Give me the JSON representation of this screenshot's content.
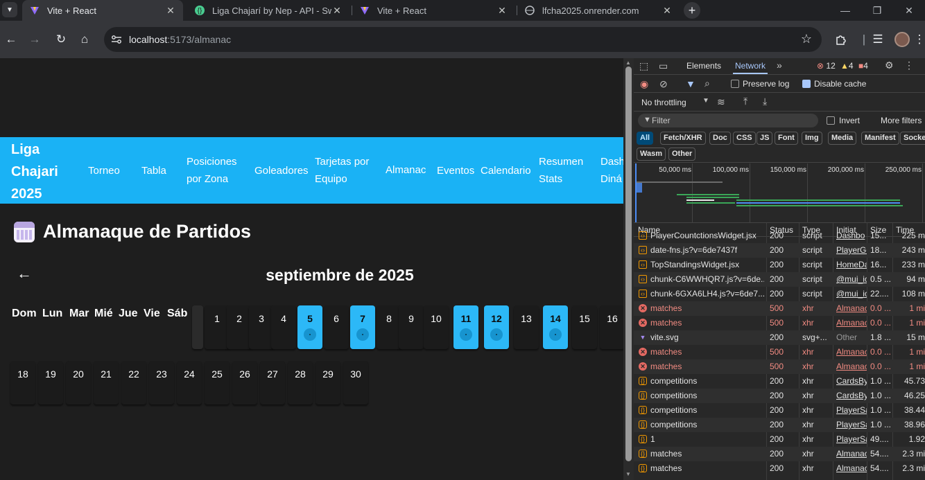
{
  "browser": {
    "tabs": [
      {
        "title": "Vite + React",
        "favicon": "vite-icon",
        "active": true
      },
      {
        "title": "Liga Chajarí by Nep - API - Swa",
        "favicon": "swagger-icon",
        "active": false
      },
      {
        "title": "Vite + React",
        "favicon": "vite-icon",
        "active": false
      },
      {
        "title": "lfcha2025.onrender.com",
        "favicon": "globe-icon",
        "active": false
      }
    ],
    "url_host": "localhost",
    "url_path": ":5173/almanac"
  },
  "app": {
    "brand": "Liga Chajari 2025",
    "nav": [
      {
        "label": "Torneo"
      },
      {
        "label": "Tabla"
      },
      {
        "label": "Posiciones por Zona"
      },
      {
        "label": "Goleadores"
      },
      {
        "label": "Tarjetas por Equipo"
      },
      {
        "label": "Almanac"
      },
      {
        "label": "Eventos"
      },
      {
        "label": "Calendario"
      },
      {
        "label": "Resumen Stats"
      },
      {
        "label": "Dash Diná"
      }
    ],
    "page_title": "Almanaque de Partidos",
    "month_label": "septiembre de 2025",
    "weekdays": [
      "Dom",
      "Lun",
      "Mar",
      "Mié",
      "Jue",
      "Vie",
      "Sáb"
    ],
    "days_with_matches": [
      5,
      7,
      11,
      12,
      14
    ],
    "days_in_month": 30
  },
  "devtools": {
    "tabs": {
      "elements": "Elements",
      "network": "Network"
    },
    "errors": "12",
    "warnings": "4",
    "issues": "4",
    "preserve_log": "Preserve log",
    "disable_cache": "Disable cache",
    "throttling": "No throttling",
    "filter_placeholder": "Filter",
    "invert": "Invert",
    "more_filters": "More filters",
    "chips": [
      "All",
      "Fetch/XHR",
      "Doc",
      "CSS",
      "JS",
      "Font",
      "Img",
      "Media",
      "Manifest",
      "Socke",
      "Wasm",
      "Other"
    ],
    "timeline_labels": [
      "50,000 ms",
      "100,000 ms",
      "150,000 ms",
      "200,000 ms",
      "250,000 ms"
    ],
    "columns": {
      "name": "Name",
      "status": "Status",
      "type": "Type",
      "initiator": "Initiat",
      "size": "Size",
      "time": "Time"
    },
    "rows": [
      {
        "name": "PlayerCountctionsWidget.jsx",
        "status": "200",
        "type": "script",
        "initiator": "Dashbo",
        "size": "15...",
        "time": "225 m",
        "kind": "js"
      },
      {
        "name": "date-fns.js?v=6de7437f",
        "status": "200",
        "type": "script",
        "initiator": "PlayerGo",
        "size": "18...",
        "time": "243 m",
        "kind": "js"
      },
      {
        "name": "TopStandingsWidget.jsx",
        "status": "200",
        "type": "script",
        "initiator": "HomeDa",
        "size": "16...",
        "time": "233 m",
        "kind": "js"
      },
      {
        "name": "chunk-C6WWHQR7.js?v=6de...",
        "status": "200",
        "type": "script",
        "initiator": "@mui_ic",
        "size": "0.5 ...",
        "time": "94 m",
        "kind": "js"
      },
      {
        "name": "chunk-6GXA6LH4.js?v=6de7...",
        "status": "200",
        "type": "script",
        "initiator": "@mui_ic",
        "size": "22....",
        "time": "108 m",
        "kind": "js"
      },
      {
        "name": "matches",
        "status": "500",
        "type": "xhr",
        "initiator": "Almanac",
        "size": "0.0 ...",
        "time": "1 mi",
        "kind": "err"
      },
      {
        "name": "matches",
        "status": "500",
        "type": "xhr",
        "initiator": "Almanac",
        "size": "0.0 ...",
        "time": "1 mi",
        "kind": "err"
      },
      {
        "name": "vite.svg",
        "status": "200",
        "type": "svg+...",
        "initiator": "Other",
        "size": "1.8 ...",
        "time": "15 m",
        "kind": "svg"
      },
      {
        "name": "matches",
        "status": "500",
        "type": "xhr",
        "initiator": "Almanac",
        "size": "0.0 ...",
        "time": "1 mi",
        "kind": "err"
      },
      {
        "name": "matches",
        "status": "500",
        "type": "xhr",
        "initiator": "Almanac",
        "size": "0.0 ...",
        "time": "1 mi",
        "kind": "err"
      },
      {
        "name": "competitions",
        "status": "200",
        "type": "xhr",
        "initiator": "CardsBy",
        "size": "1.0 ...",
        "time": "45.73",
        "kind": "fx"
      },
      {
        "name": "competitions",
        "status": "200",
        "type": "xhr",
        "initiator": "CardsBy",
        "size": "1.0 ...",
        "time": "46.25",
        "kind": "fx"
      },
      {
        "name": "competitions",
        "status": "200",
        "type": "xhr",
        "initiator": "PlayerSa",
        "size": "1.0 ...",
        "time": "38.44",
        "kind": "fx"
      },
      {
        "name": "competitions",
        "status": "200",
        "type": "xhr",
        "initiator": "PlayerSa",
        "size": "1.0 ...",
        "time": "38.96",
        "kind": "fx"
      },
      {
        "name": "1",
        "status": "200",
        "type": "xhr",
        "initiator": "PlayerSa",
        "size": "49....",
        "time": "1.92",
        "kind": "fx"
      },
      {
        "name": "matches",
        "status": "200",
        "type": "xhr",
        "initiator": "Almanac",
        "size": "54....",
        "time": "2.3 mi",
        "kind": "fx"
      },
      {
        "name": "matches",
        "status": "200",
        "type": "xhr",
        "initiator": "Almanac",
        "size": "54....",
        "time": "2.3 mi",
        "kind": "fx"
      }
    ]
  }
}
